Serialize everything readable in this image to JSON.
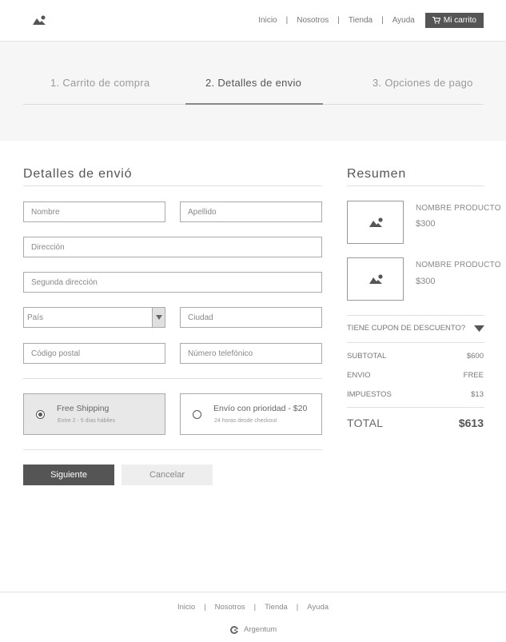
{
  "header": {
    "nav": [
      "Inicio",
      "Nosotros",
      "Tienda",
      "Ayuda"
    ],
    "cart_label": "Mi carrito",
    "separator": "|"
  },
  "steps": [
    {
      "label": "1. Carrito de compra",
      "active": false
    },
    {
      "label": "2. Detalles de envio",
      "active": true
    },
    {
      "label": "3. Opciones de pago",
      "active": false
    }
  ],
  "form": {
    "title": "Detalles de envió",
    "fields": {
      "nombre": {
        "placeholder": "Nombre",
        "value": ""
      },
      "apellido": {
        "placeholder": "Apellido",
        "value": ""
      },
      "direccion": {
        "placeholder": "Dirección",
        "value": ""
      },
      "direccion2": {
        "placeholder": "Segunda dirección",
        "value": ""
      },
      "pais": {
        "selected": "País"
      },
      "ciudad": {
        "placeholder": "Ciudad",
        "value": ""
      },
      "postal": {
        "placeholder": "Código postal",
        "value": ""
      },
      "telefono": {
        "placeholder": "Número telefónico",
        "value": ""
      }
    },
    "shipping": [
      {
        "title": "Free Shipping",
        "subtitle": "Entre 2 - 5 días hábiles",
        "selected": true
      },
      {
        "title": "Envío con prioridad - $20",
        "subtitle": "24 horas desde checkout",
        "selected": false
      }
    ],
    "next_label": "Siguiente",
    "cancel_label": "Cancelar"
  },
  "summary": {
    "title": "Resumen",
    "products": [
      {
        "name": "NOMBRE PRODUCTO",
        "price": "$300"
      },
      {
        "name": "NOMBRE PRODUCTO",
        "price": "$300"
      }
    ],
    "coupon_label": "TIENE CUPON DE DESCUENTO?",
    "lines": [
      {
        "label": "SUBTOTAL",
        "value": "$600"
      },
      {
        "label": "ENVIO",
        "value": "FREE"
      },
      {
        "label": "IMPUESTOS",
        "value": "$13"
      }
    ],
    "total_label": "TOTAL",
    "total_value": "$613"
  },
  "footer": {
    "nav": [
      "Inicio",
      "Nosotros",
      "Tienda",
      "Ayuda"
    ],
    "brand": "Argentum"
  },
  "icons": {
    "logo": "image-placeholder-icon",
    "cart": "cart-icon",
    "select": "chevron-down-icon",
    "coupon": "caret-down-icon",
    "brand": "brand-logo-icon"
  },
  "colors": {
    "primary_button": "#555555",
    "step_background": "#f6f6f6",
    "selected_shipping": "#e8e8e8"
  }
}
